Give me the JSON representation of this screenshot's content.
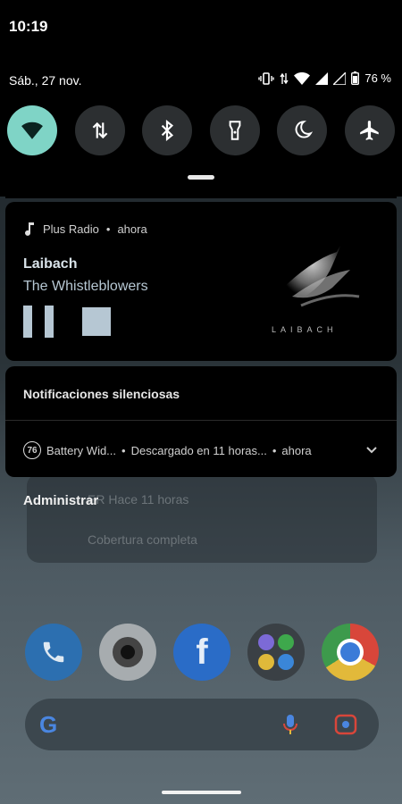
{
  "status_bar": {
    "time": "10:19",
    "battery_percent": "76 %"
  },
  "shade": {
    "date": "Sáb., 27 nov.",
    "quick_settings": [
      {
        "icon": "wifi-icon",
        "active": true
      },
      {
        "icon": "data-transfer-icon",
        "active": false
      },
      {
        "icon": "bluetooth-icon",
        "active": false
      },
      {
        "icon": "flashlight-icon",
        "active": false
      },
      {
        "icon": "moon-icon",
        "active": false
      },
      {
        "icon": "airplane-icon",
        "active": false
      }
    ]
  },
  "media": {
    "app_name": "Plus Radio",
    "time": "ahora",
    "separator": "•",
    "title": "Laibach",
    "artist": "The Whistleblowers",
    "album_art_text": "LAIBACH"
  },
  "silent": {
    "header": "Notificaciones silenciosas",
    "notification": {
      "badge": "76",
      "app": "Battery Wid...",
      "text": "Descargado en 11 horas...",
      "time": "ahora"
    }
  },
  "manage_label": "Administrar",
  "background_widget": {
    "line1": "ER  Hace 11 horas",
    "line2": "Cobertura completa"
  },
  "colors": {
    "accent": "#7fd4c6",
    "card_bg": "#000000",
    "media_controls": "#b6c7d3"
  }
}
